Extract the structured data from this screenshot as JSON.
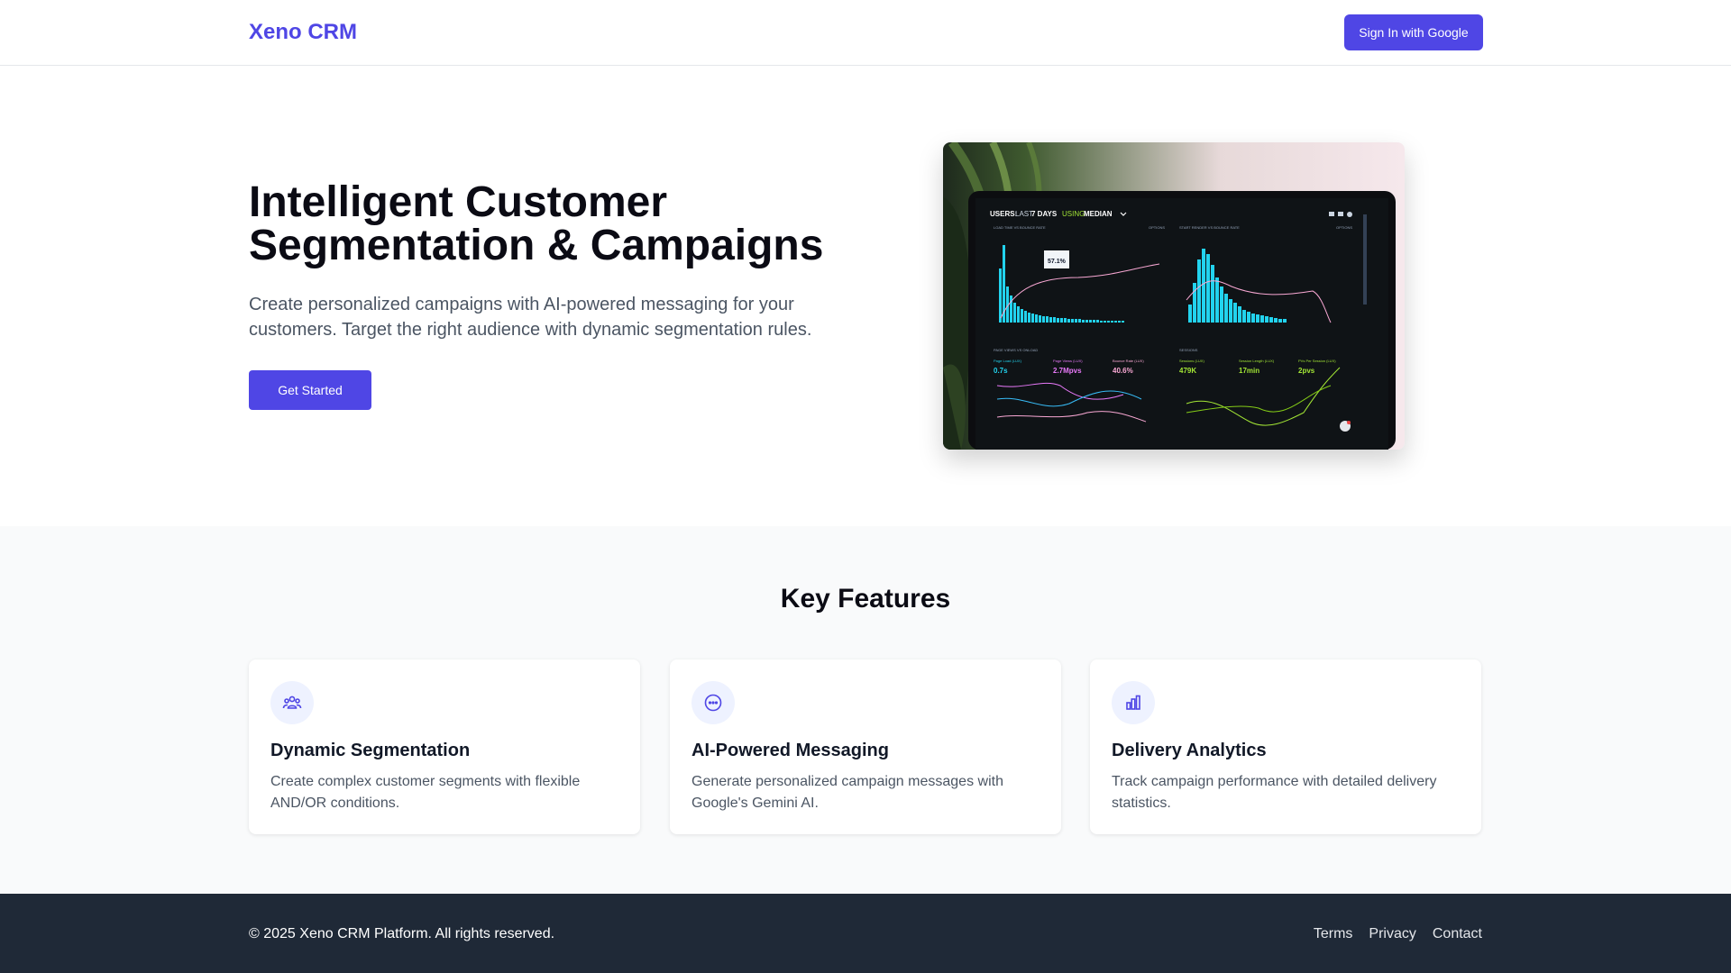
{
  "header": {
    "logo": "Xeno CRM",
    "signin_label": "Sign In with Google"
  },
  "hero": {
    "title": "Intelligent Customer Segmentation & Campaigns",
    "description": "Create personalized campaigns with AI-powered messaging for your customers. Target the right audience with dynamic segmentation rules.",
    "cta_label": "Get Started",
    "dashboard": {
      "header_prefix": "USERS:",
      "header_last": "LAST",
      "header_days": "7 DAYS",
      "header_using": "USING",
      "header_median": "MEDIAN",
      "panel1_title": "LOAD TIME VS BOUNCE RATE",
      "panel2_title": "START RENDER VS BOUNCE RATE",
      "options": "OPTIONS",
      "tooltip": "57.1%",
      "panel3_title": "PAGE VIEWS VS ONLOAD",
      "panel4_title": "SESSIONS",
      "metrics": [
        {
          "label": "Page Load (LUX)",
          "value": "0.7s",
          "color": "#22d3ee"
        },
        {
          "label": "Page Views (LUX)",
          "value": "2.7Mpvs",
          "color": "#e879f9"
        },
        {
          "label": "Bounce Rate (LUX)",
          "value": "40.6%",
          "color": "#f9a8d4"
        },
        {
          "label": "Sessions (LUX)",
          "value": "479K",
          "color": "#a3e635"
        },
        {
          "label": "Session Length (LUX)",
          "value": "17min",
          "color": "#a3e635"
        },
        {
          "label": "PVs Per Session (LUX)",
          "value": "2pvs",
          "color": "#a3e635"
        }
      ]
    }
  },
  "features": {
    "title": "Key Features",
    "items": [
      {
        "icon": "users-group-icon",
        "title": "Dynamic Segmentation",
        "description": "Create complex customer segments with flexible AND/OR conditions."
      },
      {
        "icon": "chat-bubble-icon",
        "title": "AI-Powered Messaging",
        "description": "Generate personalized campaign messages with Google's Gemini AI."
      },
      {
        "icon": "bar-chart-icon",
        "title": "Delivery Analytics",
        "description": "Track campaign performance with detailed delivery statistics."
      }
    ]
  },
  "footer": {
    "copyright": "© 2025 Xeno CRM Platform. All rights reserved.",
    "links": [
      "Terms",
      "Privacy",
      "Contact"
    ]
  },
  "colors": {
    "brand": "#4f46e5",
    "footer_bg": "#1f2937",
    "features_bg": "#f9fafb",
    "icon_bg": "#eef2ff"
  }
}
